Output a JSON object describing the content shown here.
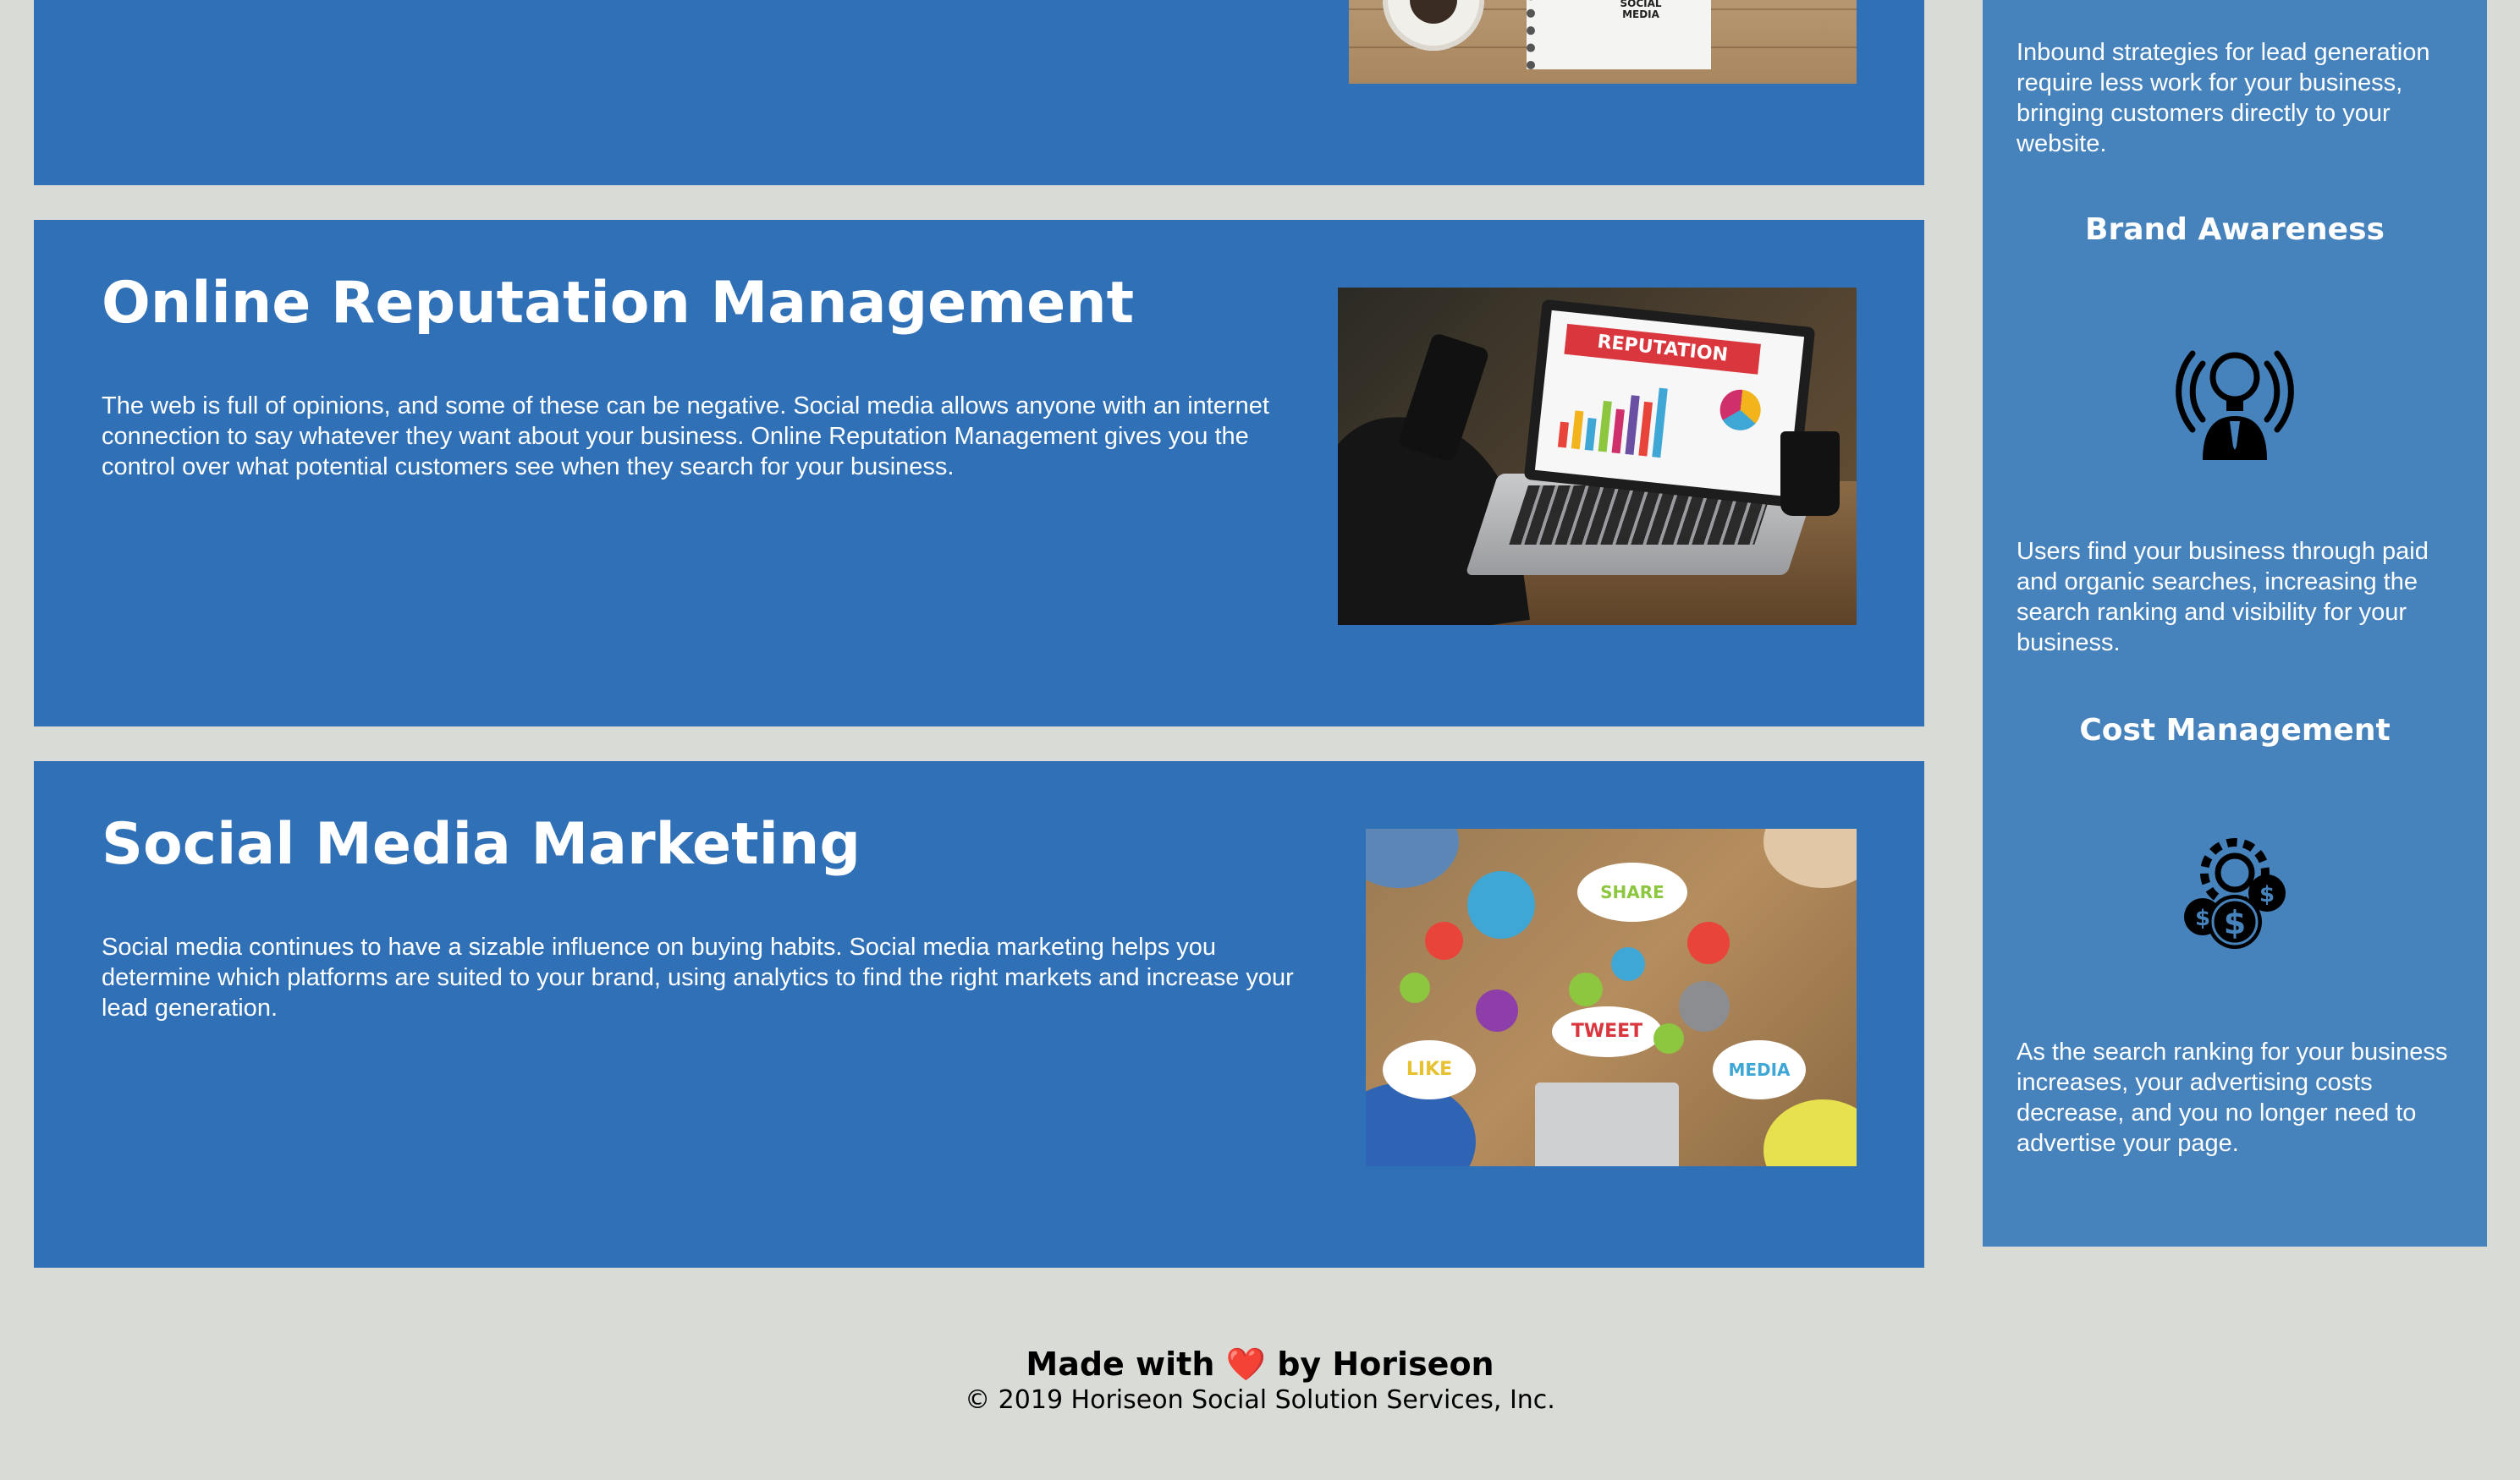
{
  "sections": {
    "top": {
      "notebook_text": "SOCIAL MEDIA"
    },
    "orm": {
      "title": "Online Reputation Management",
      "body": "The web is full of opinions, and some of these can be negative. Social media allows anyone with an internet connection to say whatever they want about your business. Online Reputation Management gives you the control over what potential customers see when they search for your business.",
      "image_banner": "REPUTATION"
    },
    "smm": {
      "title": "Social Media Marketing",
      "body": "Social media continues to have a sizable influence on buying habits. Social media marketing helps you determine which platforms are suited to your brand, using analytics to find the right markets and increase your lead generation.",
      "image_bubbles": [
        "SHARE",
        "TWEET",
        "LIKE",
        "MEDIA"
      ]
    }
  },
  "sidebar": {
    "lead_gen_text": "Inbound strategies for lead generation require less work for your business, bringing customers directly to your website.",
    "brand_title": "Brand Awareness",
    "brand_icon": "lightbulb-person-icon",
    "brand_text": "Users find your business through paid and organic searches, increasing the search ranking and visibility for your business.",
    "cost_title": "Cost Management",
    "cost_icon": "gear-dollar-icon",
    "cost_text": "As the search ranking for your business increases, your advertising costs decrease, and you no longer need to advertise your page."
  },
  "footer": {
    "made_prefix": "Made with",
    "heart": "❤️",
    "made_suffix": "by Horiseon",
    "copyright": "© 2019 Horiseon Social Solution Services, Inc."
  },
  "colors": {
    "page_bg": "#d9dcd6",
    "section_bg": "#2f70b7",
    "sidebar_bg": "#4683bd",
    "text": "#ffffff"
  }
}
